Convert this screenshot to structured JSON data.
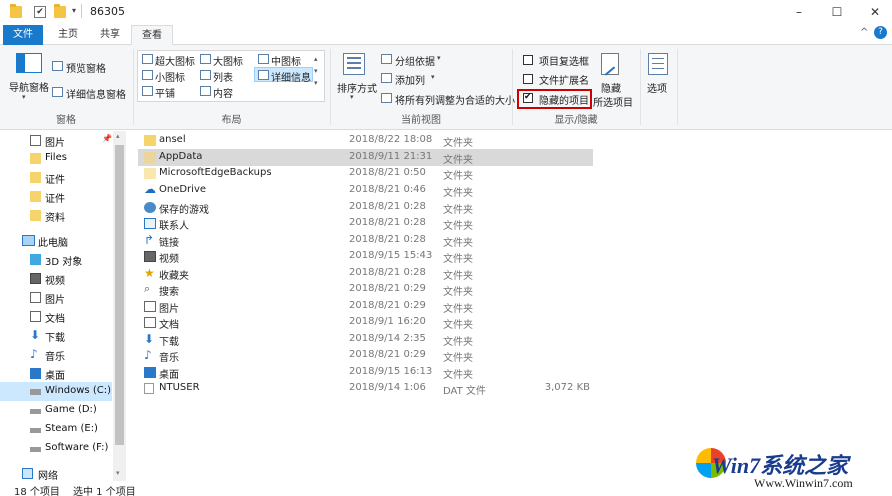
{
  "window": {
    "title": "86305"
  },
  "tabs": [
    {
      "label": "文件"
    },
    {
      "label": "主页"
    },
    {
      "label": "共享"
    },
    {
      "label": "查看"
    }
  ],
  "ribbon": {
    "panes": {
      "nav_pane": "导航窗格",
      "preview_pane": "预览窗格",
      "details_pane": "详细信息窗格",
      "group_label": "窗格"
    },
    "layout": {
      "items": [
        "超大图标",
        "大图标",
        "中图标",
        "小图标",
        "列表",
        "详细信息",
        "平铺",
        "内容"
      ],
      "group_label": "布局"
    },
    "current_view": {
      "sort_by": "排序方式",
      "group_by": "分组依据",
      "add_column": "添加列",
      "size_all_columns": "将所有列调整为合适的大小",
      "group_label": "当前视图"
    },
    "show_hide": {
      "item_checkboxes": "项目复选框",
      "file_name_extensions": "文件扩展名",
      "hidden_items": "隐藏的项目",
      "hide_selected": "隐藏",
      "hide_selected_2": "所选项目",
      "group_label": "显示/隐藏",
      "item_checkboxes_checked": false,
      "file_name_extensions_checked": false,
      "hidden_items_checked": true
    },
    "options": {
      "label": "选项"
    }
  },
  "nav": [
    {
      "label": "图片",
      "icon": "pictures-icon"
    },
    {
      "label": "Files",
      "icon": "folder-icon"
    },
    {
      "label": "证件",
      "icon": "folder-icon"
    },
    {
      "label": "证件",
      "icon": "folder-icon"
    },
    {
      "label": "资料",
      "icon": "folder-icon"
    },
    {
      "label": "此电脑",
      "icon": "computer-icon"
    },
    {
      "label": "3D 对象",
      "icon": "3d-objects-icon"
    },
    {
      "label": "视频",
      "icon": "videos-icon"
    },
    {
      "label": "图片",
      "icon": "pictures-icon"
    },
    {
      "label": "文档",
      "icon": "documents-icon"
    },
    {
      "label": "下载",
      "icon": "downloads-icon"
    },
    {
      "label": "音乐",
      "icon": "music-icon"
    },
    {
      "label": "桌面",
      "icon": "desktop-icon"
    },
    {
      "label": "Windows (C:)",
      "icon": "drive-icon"
    },
    {
      "label": "Game (D:)",
      "icon": "drive-icon"
    },
    {
      "label": "Steam (E:)",
      "icon": "drive-icon"
    },
    {
      "label": "Software (F:)",
      "icon": "drive-icon"
    },
    {
      "label": "网络",
      "icon": "network-icon"
    }
  ],
  "files": [
    {
      "name": "ansel",
      "date": "2018/8/22 18:08",
      "type": "文件夹",
      "size": "",
      "icon": "folder-icon"
    },
    {
      "name": "AppData",
      "date": "2018/9/11 21:31",
      "type": "文件夹",
      "size": "",
      "icon": "hidden-folder-icon"
    },
    {
      "name": "MicrosoftEdgeBackups",
      "date": "2018/8/21 0:50",
      "type": "文件夹",
      "size": "",
      "icon": "folder-icon"
    },
    {
      "name": "OneDrive",
      "date": "2018/8/21 0:46",
      "type": "文件夹",
      "size": "",
      "icon": "onedrive-icon"
    },
    {
      "name": "保存的游戏",
      "date": "2018/8/21 0:28",
      "type": "文件夹",
      "size": "",
      "icon": "saved-games-icon"
    },
    {
      "name": "联系人",
      "date": "2018/8/21 0:28",
      "type": "文件夹",
      "size": "",
      "icon": "contacts-icon"
    },
    {
      "name": "链接",
      "date": "2018/8/21 0:28",
      "type": "文件夹",
      "size": "",
      "icon": "links-icon"
    },
    {
      "name": "视频",
      "date": "2018/9/15 15:43",
      "type": "文件夹",
      "size": "",
      "icon": "videos-icon"
    },
    {
      "name": "收藏夹",
      "date": "2018/8/21 0:28",
      "type": "文件夹",
      "size": "",
      "icon": "favorites-icon"
    },
    {
      "name": "搜索",
      "date": "2018/8/21 0:29",
      "type": "文件夹",
      "size": "",
      "icon": "search-icon"
    },
    {
      "name": "图片",
      "date": "2018/8/21 0:29",
      "type": "文件夹",
      "size": "",
      "icon": "pictures-icon"
    },
    {
      "name": "文档",
      "date": "2018/9/1 16:20",
      "type": "文件夹",
      "size": "",
      "icon": "documents-icon"
    },
    {
      "name": "下载",
      "date": "2018/9/14 2:35",
      "type": "文件夹",
      "size": "",
      "icon": "downloads-icon"
    },
    {
      "name": "音乐",
      "date": "2018/8/21 0:29",
      "type": "文件夹",
      "size": "",
      "icon": "music-icon"
    },
    {
      "name": "桌面",
      "date": "2018/9/15 16:13",
      "type": "文件夹",
      "size": "",
      "icon": "desktop-icon"
    },
    {
      "name": "NTUSER",
      "date": "2018/9/14 1:06",
      "type": "DAT 文件",
      "size": "3,072 KB",
      "icon": "file-icon"
    }
  ],
  "status": {
    "count": "18 个项目",
    "selected": "选中 1 个项目"
  },
  "watermark": {
    "logo": "Win7系统之家",
    "url": "Www.Winwin7.com"
  },
  "colors": {
    "accent": "#1979ca",
    "highlight_box": "#d00000",
    "selection": "#cce8ff"
  }
}
